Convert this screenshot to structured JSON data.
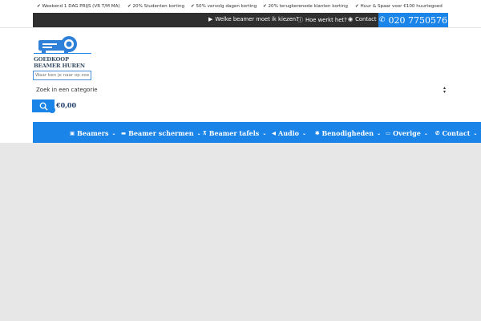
{
  "usps": [
    "✔ Weekend 1 DAG PRIJS (VR T/M MA)",
    "✔ 20% Studenten korting",
    "✔ 50% vervolg dagen korting",
    "✔ 20% terugkerenede klanten korting",
    "✔ Huur & Spaar voor €100 huurtegoed"
  ],
  "infobar": {
    "which_beamer": "Welke beamer moet ik kiezen?",
    "how_it_works": "Hoe werkt het?",
    "contact": "Contact",
    "phone": "020 7750576"
  },
  "logo": {
    "line1": "GOEDKOOP",
    "line2": "BEAMER HUREN"
  },
  "search": {
    "placeholder": "Waar ben je naar op zoek?",
    "category_label": "Zoek in een categorie"
  },
  "cart": {
    "total": "€0,00"
  },
  "nav": [
    {
      "label": "Beamers",
      "icon": "projector-icon"
    },
    {
      "label": "Beamer schermen",
      "icon": "screen-icon"
    },
    {
      "label": "Beamer tafels",
      "icon": "table-icon"
    },
    {
      "label": "Audio",
      "icon": "speaker-icon"
    },
    {
      "label": "Benodigheden",
      "icon": "gear-icon"
    },
    {
      "label": "Overige",
      "icon": "laptop-icon"
    },
    {
      "label": "Contact",
      "icon": "phone-icon"
    }
  ],
  "colors": {
    "brand_blue": "#1a84e8",
    "dark_bar": "#2f2f2f",
    "page_bg": "#e7e7e7"
  }
}
